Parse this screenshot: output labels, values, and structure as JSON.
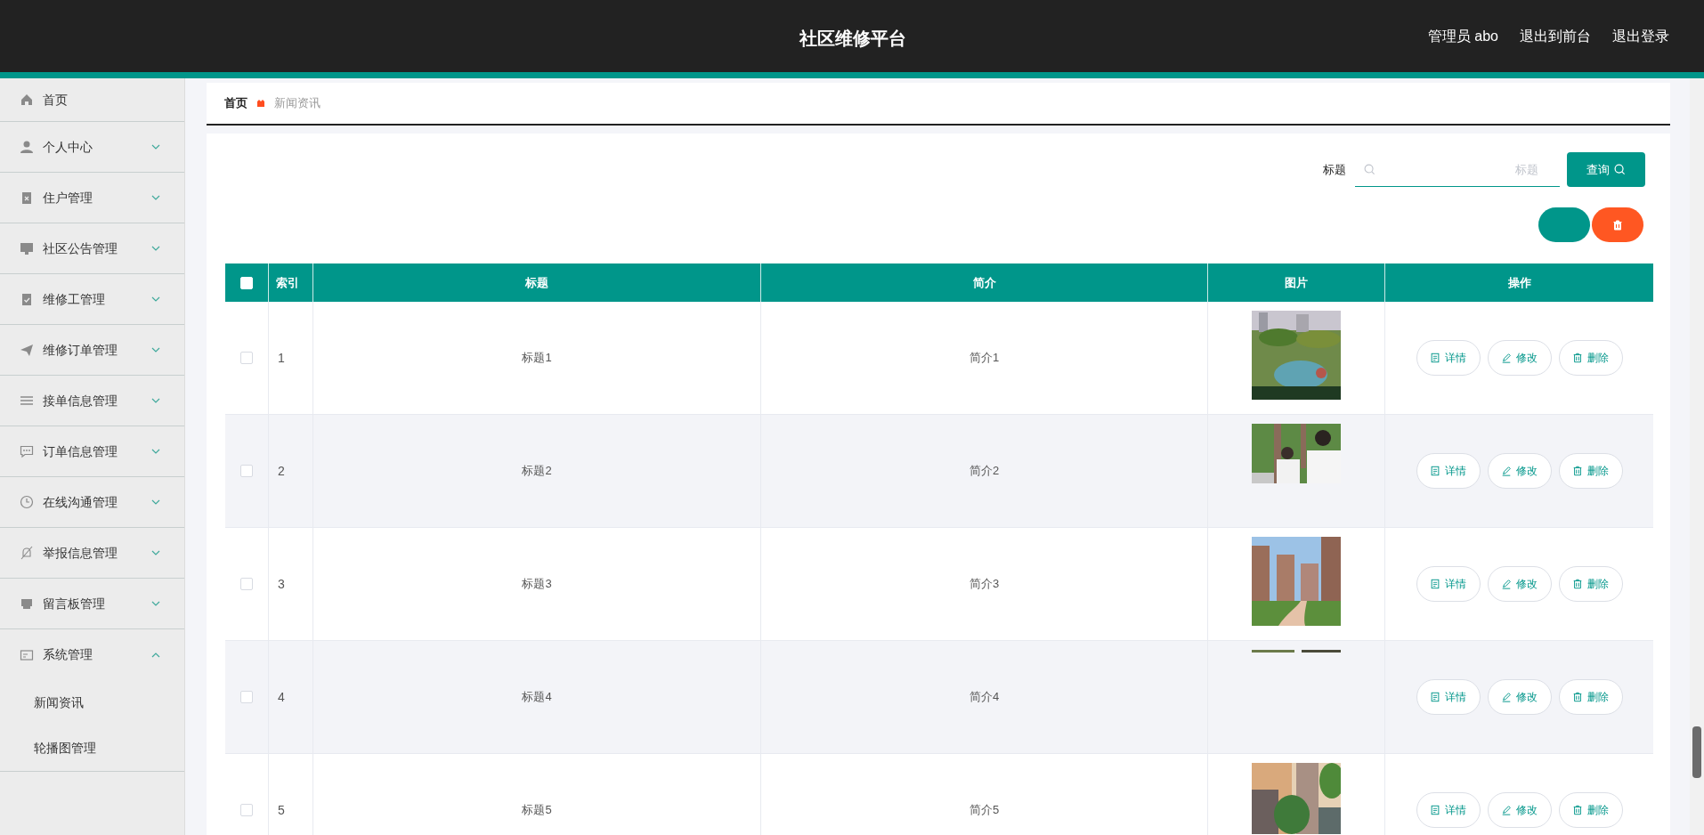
{
  "header": {
    "title": "社区维修平台",
    "links": [
      "管理员 abo",
      "退出到前台",
      "退出登录"
    ]
  },
  "sidebar": {
    "items": [
      {
        "label": "首页"
      },
      {
        "label": "个人中心",
        "expanded": false
      },
      {
        "label": "住户管理",
        "expanded": false
      },
      {
        "label": "社区公告管理",
        "expanded": false
      },
      {
        "label": "维修工管理",
        "expanded": false
      },
      {
        "label": "维修订单管理",
        "expanded": false
      },
      {
        "label": "接单信息管理",
        "expanded": false
      },
      {
        "label": "订单信息管理",
        "expanded": false
      },
      {
        "label": "在线沟通管理",
        "expanded": false
      },
      {
        "label": "举报信息管理",
        "expanded": false
      },
      {
        "label": "留言板管理",
        "expanded": false
      },
      {
        "label": "系统管理",
        "expanded": true,
        "children": [
          {
            "label": "新闻资讯"
          },
          {
            "label": "轮播图管理"
          }
        ]
      }
    ]
  },
  "breadcrumb": [
    "首页",
    "新闻资讯"
  ],
  "search": {
    "label": "标题",
    "placeholder": "标题",
    "button": "查询"
  },
  "table": {
    "select_all_checked": false,
    "columns": [
      "索引",
      "标题",
      "简介",
      "图片",
      "操作"
    ],
    "rows": [
      {
        "index": "1",
        "title": "标题1",
        "intro": "简介1",
        "checked": false,
        "image_broken": false,
        "actions": [
          "详情",
          "修改",
          "删除"
        ]
      },
      {
        "index": "2",
        "title": "标题2",
        "intro": "简介2",
        "checked": false,
        "image_broken": false,
        "actions": [
          "详情",
          "修改",
          "删除"
        ]
      },
      {
        "index": "3",
        "title": "标题3",
        "intro": "简介3",
        "checked": false,
        "image_broken": false,
        "actions": [
          "详情",
          "修改",
          "删除"
        ]
      },
      {
        "index": "4",
        "title": "标题4",
        "intro": "简介4",
        "checked": false,
        "image_broken": true,
        "actions": [
          "详情",
          "修改",
          "删除"
        ]
      },
      {
        "index": "5",
        "title": "标题5",
        "intro": "简介5",
        "checked": false,
        "image_broken": false,
        "actions": [
          "详情",
          "修改",
          "删除"
        ]
      }
    ]
  }
}
